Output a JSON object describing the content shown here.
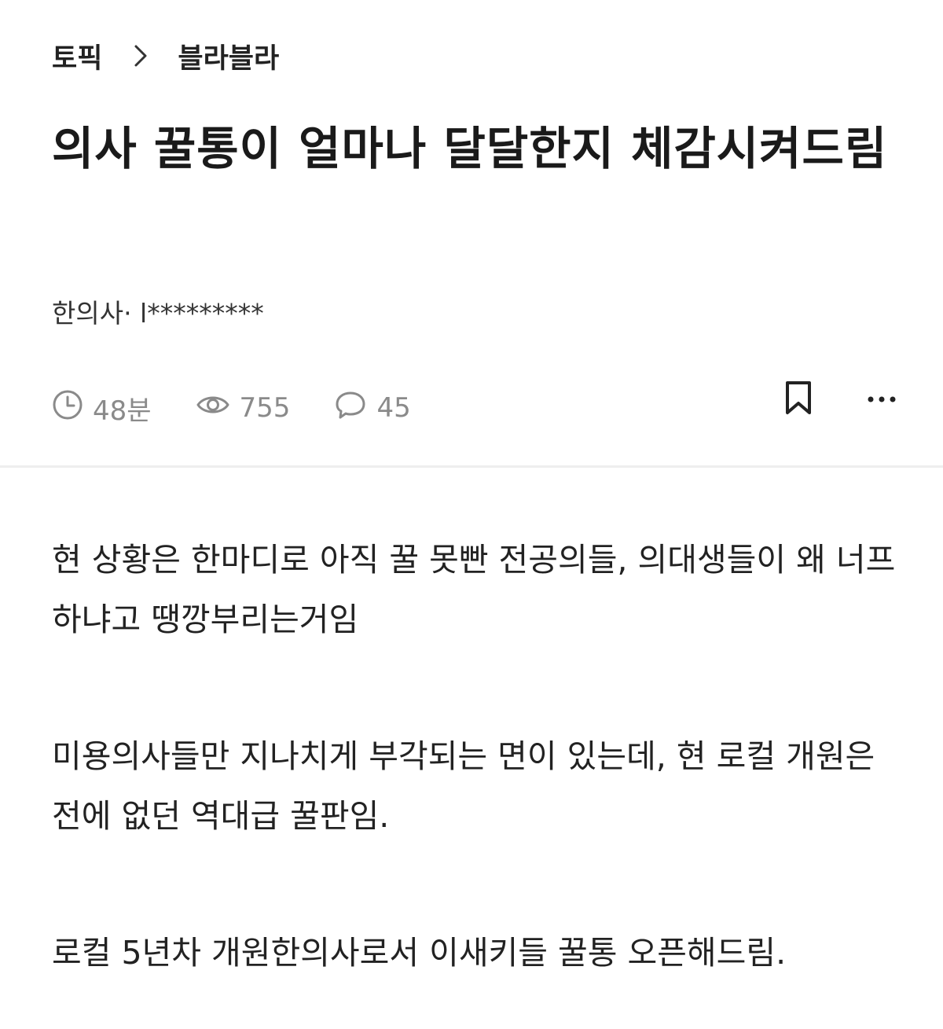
{
  "breadcrumb": {
    "items": [
      "토픽",
      "블라블라"
    ],
    "separator_icon": "chevron-right-icon"
  },
  "post": {
    "title": "의사 꿀통이 얼마나 달달한지 체감시켜드림",
    "author_line": "한의사· l*********",
    "stats": {
      "time": "48분",
      "views": "755",
      "comments": "45"
    },
    "paragraphs": [
      "현 상황은 한마디로 아직 꿀 못빤 전공의들, 의대생들이 왜 너프하냐고 땡깡부리는거임",
      "미용의사들만 지나치게 부각되는 면이 있는데, 현 로컬 개원은 전에 없던 역대급 꿀판임.",
      "로컬 5년차 개원한의사로서 이새키들 꿀통 오픈해드림."
    ]
  },
  "icons": {
    "time": "clock-icon",
    "views": "eye-icon",
    "comments": "speech-bubble-icon",
    "bookmark": "bookmark-icon",
    "more": "more-horizontal-icon"
  },
  "colors": {
    "text_primary": "#1a1a1a",
    "text_meta": "#8a8a8a",
    "divider": "#eeeeee"
  }
}
